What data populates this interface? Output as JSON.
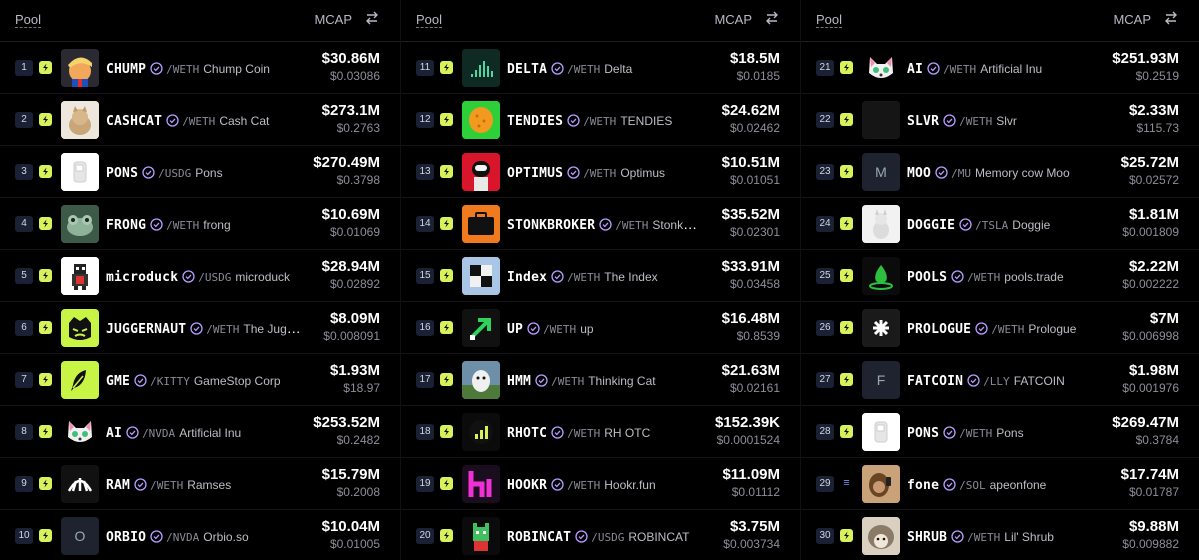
{
  "header": {
    "pool_label": "Pool",
    "mcap_label": "MCAP",
    "swap_icon": "swap-arrows-icon"
  },
  "columns": [
    {
      "rows": [
        {
          "rank": "1",
          "symbol": "CHUMP",
          "pair": "/WETH",
          "full_name": "Chump Coin",
          "mcap": "$30.86M",
          "price": "$0.03086",
          "avatar": "trump-avatar",
          "bg": "#2b2a33",
          "letter": ""
        },
        {
          "rank": "2",
          "symbol": "CASHCAT",
          "pair": "/WETH",
          "full_name": "Cash Cat",
          "mcap": "$273.1M",
          "price": "$0.2763",
          "avatar": "cat-photo",
          "bg": "#eee7de",
          "letter": ""
        },
        {
          "rank": "3",
          "symbol": "PONS",
          "pair": "/USDG",
          "full_name": "Pons",
          "mcap": "$270.49M",
          "price": "$0.3798",
          "avatar": "pons-logo",
          "bg": "#ffffff",
          "letter": ""
        },
        {
          "rank": "4",
          "symbol": "FRONG",
          "pair": "/WETH",
          "full_name": "frong",
          "mcap": "$10.69M",
          "price": "$0.01069",
          "avatar": "frog-photo",
          "bg": "#3f5a4a",
          "letter": ""
        },
        {
          "rank": "5",
          "symbol": "microduck",
          "pair": "/USDG",
          "full_name": "microduck",
          "mcap": "$28.94M",
          "price": "$0.02892",
          "avatar": "pixel-duck",
          "bg": "#ffffff",
          "letter": ""
        },
        {
          "rank": "6",
          "symbol": "JUGGERNAUT",
          "pair": "/WETH",
          "full_name": "The Juggernaut",
          "mcap": "$8.09M",
          "price": "$0.008091",
          "avatar": "juggernaut-face",
          "bg": "#c8f545",
          "letter": ""
        },
        {
          "rank": "7",
          "symbol": "GME",
          "pair": "/KITTY",
          "full_name": "GameStop Corp",
          "mcap": "$1.93M",
          "price": "$18.97",
          "avatar": "feather-logo",
          "bg": "#c8f545",
          "letter": ""
        },
        {
          "rank": "8",
          "symbol": "AI",
          "pair": "/NVDA",
          "full_name": "Artificial Inu",
          "mcap": "$253.52M",
          "price": "$0.2482",
          "avatar": "inu-dog",
          "bg": "#000000",
          "letter": ""
        },
        {
          "rank": "9",
          "symbol": "RAM",
          "pair": "/WETH",
          "full_name": "Ramses",
          "mcap": "$15.79M",
          "price": "$0.2008",
          "avatar": "ramses-logo",
          "bg": "#111111",
          "letter": ""
        },
        {
          "rank": "10",
          "symbol": "ORBIO",
          "pair": "/NVDA",
          "full_name": "Orbio.so",
          "mcap": "$10.04M",
          "price": "$0.01005",
          "avatar": "letter-avatar",
          "bg": "#1f2330",
          "letter": "O"
        }
      ]
    },
    {
      "rows": [
        {
          "rank": "11",
          "symbol": "DELTA",
          "pair": "/WETH",
          "full_name": "Delta",
          "mcap": "$18.5M",
          "price": "$0.0185",
          "avatar": "delta-logo",
          "bg": "#0f2a22",
          "letter": ""
        },
        {
          "rank": "12",
          "symbol": "TENDIES",
          "pair": "/WETH",
          "full_name": "TENDIES",
          "mcap": "$24.62M",
          "price": "$0.02462",
          "avatar": "tendie-nugget",
          "bg": "#2ed03a",
          "letter": ""
        },
        {
          "rank": "13",
          "symbol": "OPTIMUS",
          "pair": "/WETH",
          "full_name": "Optimus",
          "mcap": "$10.51M",
          "price": "$0.01051",
          "avatar": "robot-avatar",
          "bg": "#d8152b",
          "letter": ""
        },
        {
          "rank": "14",
          "symbol": "STONKBROKER",
          "pair": "/WETH",
          "full_name": "Stonkbroker",
          "mcap": "$35.52M",
          "price": "$0.02301",
          "avatar": "briefcase-icon",
          "bg": "#f07a1e",
          "letter": ""
        },
        {
          "rank": "15",
          "symbol": "Index",
          "pair": "/WETH",
          "full_name": "The Index",
          "mcap": "$33.91M",
          "price": "$0.03458",
          "avatar": "checker-logo",
          "bg": "#a9c6e6",
          "letter": ""
        },
        {
          "rank": "16",
          "symbol": "UP",
          "pair": "/WETH",
          "full_name": "up",
          "mcap": "$16.48M",
          "price": "$0.8539",
          "avatar": "up-arrow-logo",
          "bg": "#111111",
          "letter": ""
        },
        {
          "rank": "17",
          "symbol": "HMM",
          "pair": "/WETH",
          "full_name": "Thinking Cat",
          "mcap": "$21.63M",
          "price": "$0.02161",
          "avatar": "cat-photo-2",
          "bg": "#6d8fa8",
          "letter": ""
        },
        {
          "rank": "18",
          "symbol": "RHOTC",
          "pair": "/WETH",
          "full_name": "RH OTC",
          "mcap": "$152.39K",
          "price": "$0.0001524",
          "avatar": "bars-logo",
          "bg": "#0b0b0b",
          "letter": ""
        },
        {
          "rank": "19",
          "symbol": "HOOKR",
          "pair": "/WETH",
          "full_name": "Hookr.fun",
          "mcap": "$11.09M",
          "price": "$0.01112",
          "avatar": "hookr-logo",
          "bg": "#1a0d1e",
          "letter": ""
        },
        {
          "rank": "20",
          "symbol": "ROBINCAT",
          "pair": "/USDG",
          "full_name": "ROBINCAT",
          "mcap": "$3.75M",
          "price": "$0.003734",
          "avatar": "pixel-cat",
          "bg": "#0b0b0b",
          "letter": ""
        }
      ]
    },
    {
      "rows": [
        {
          "rank": "21",
          "symbol": "AI",
          "pair": "/WETH",
          "full_name": "Artificial Inu",
          "mcap": "$251.93M",
          "price": "$0.2519",
          "avatar": "inu-dog",
          "bg": "#000000",
          "letter": ""
        },
        {
          "rank": "22",
          "symbol": "SLVR",
          "pair": "/WETH",
          "full_name": "Slvr",
          "mcap": "$2.33M",
          "price": "$115.73",
          "avatar": "slvr-logo",
          "bg": "#151515",
          "letter": ""
        },
        {
          "rank": "23",
          "symbol": "MOO",
          "pair": "/MU",
          "full_name": "Memory cow Moo",
          "mcap": "$25.72M",
          "price": "$0.02572",
          "avatar": "letter-avatar",
          "bg": "#1f2330",
          "letter": "M"
        },
        {
          "rank": "24",
          "symbol": "DOGGIE",
          "pair": "/TSLA",
          "full_name": "Doggie",
          "mcap": "$1.81M",
          "price": "$0.001809",
          "avatar": "white-dog",
          "bg": "#f2f2f2",
          "letter": ""
        },
        {
          "rank": "25",
          "symbol": "POOLS",
          "pair": "/WETH",
          "full_name": "pools.trade",
          "mcap": "$2.22M",
          "price": "$0.002222",
          "avatar": "drop-logo",
          "bg": "#0b0b0b",
          "letter": ""
        },
        {
          "rank": "26",
          "symbol": "PROLOGUE",
          "pair": "/WETH",
          "full_name": "Prologue",
          "mcap": "$7M",
          "price": "$0.006998",
          "avatar": "star-logo",
          "bg": "#1a1a1a",
          "letter": ""
        },
        {
          "rank": "27",
          "symbol": "FATCOIN",
          "pair": "/LLY",
          "full_name": "FATCOIN",
          "mcap": "$1.98M",
          "price": "$0.001976",
          "avatar": "letter-avatar",
          "bg": "#1f2330",
          "letter": "F"
        },
        {
          "rank": "28",
          "symbol": "PONS",
          "pair": "/WETH",
          "full_name": "Pons",
          "mcap": "$269.47M",
          "price": "$0.3784",
          "avatar": "pons-logo",
          "bg": "#ffffff",
          "letter": ""
        },
        {
          "rank": "29",
          "symbol": "fone",
          "pair": "/SOL",
          "full_name": "apeonfone",
          "mcap": "$17.74M",
          "price": "$0.01787",
          "avatar": "ape-photo",
          "bg": "#caa27a",
          "letter": ""
        },
        {
          "rank": "30",
          "symbol": "SHRUB",
          "pair": "/WETH",
          "full_name": "Lil' Shrub",
          "mcap": "$9.88M",
          "price": "$0.009882",
          "avatar": "hedgehog-photo",
          "bg": "#d9d0c0",
          "letter": ""
        }
      ]
    }
  ]
}
